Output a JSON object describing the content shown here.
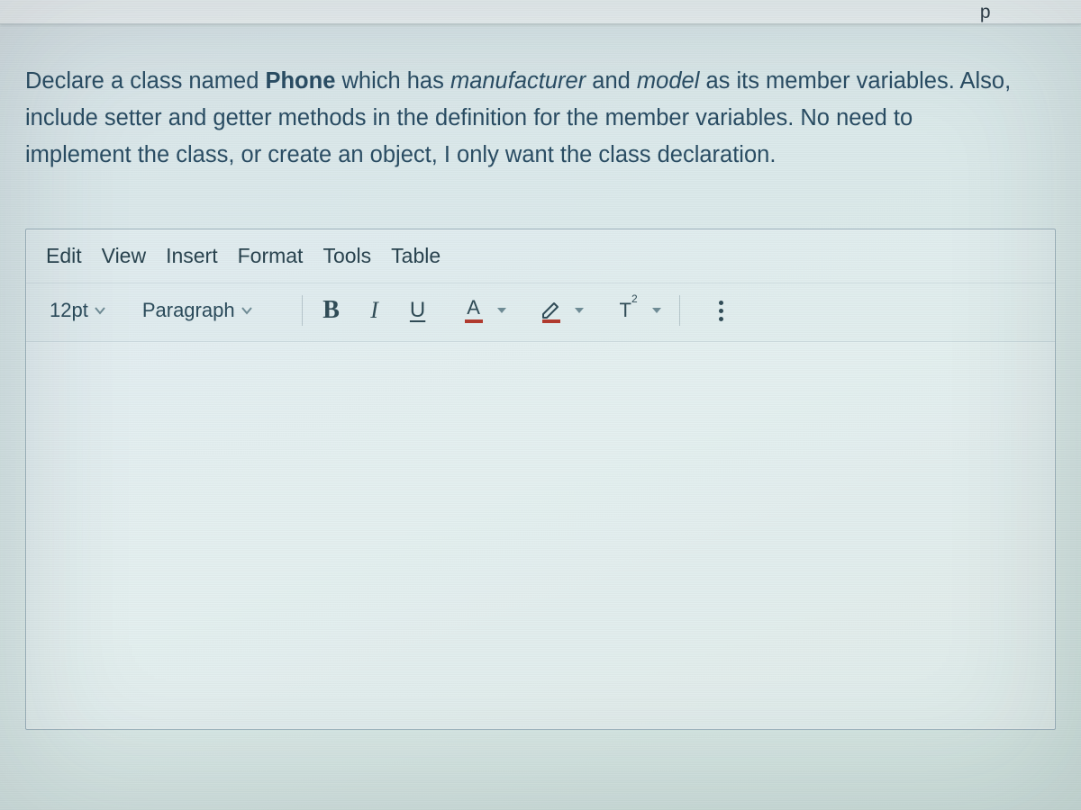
{
  "top_fragment": "p",
  "prompt": {
    "seg1": "Declare a class named ",
    "classname": "Phone",
    "seg2": " which has ",
    "var1": "manufacturer",
    "seg3": " and ",
    "var2": "model",
    "seg4": " as its member variables. Also, include setter and getter methods in the definition for the member variables. No need to implement the class, or create an object, I only want the class declaration."
  },
  "editor": {
    "menu": {
      "edit": "Edit",
      "view": "View",
      "insert": "Insert",
      "format": "Format",
      "tools": "Tools",
      "table": "Table"
    },
    "toolbar": {
      "font_size": "12pt",
      "block_format": "Paragraph",
      "bold": "B",
      "italic": "I",
      "underline": "U",
      "text_color_letter": "A",
      "text_color_swatch": "#b23a2e",
      "highlight_swatch": "#b23a2e",
      "superscript": "T²"
    }
  }
}
